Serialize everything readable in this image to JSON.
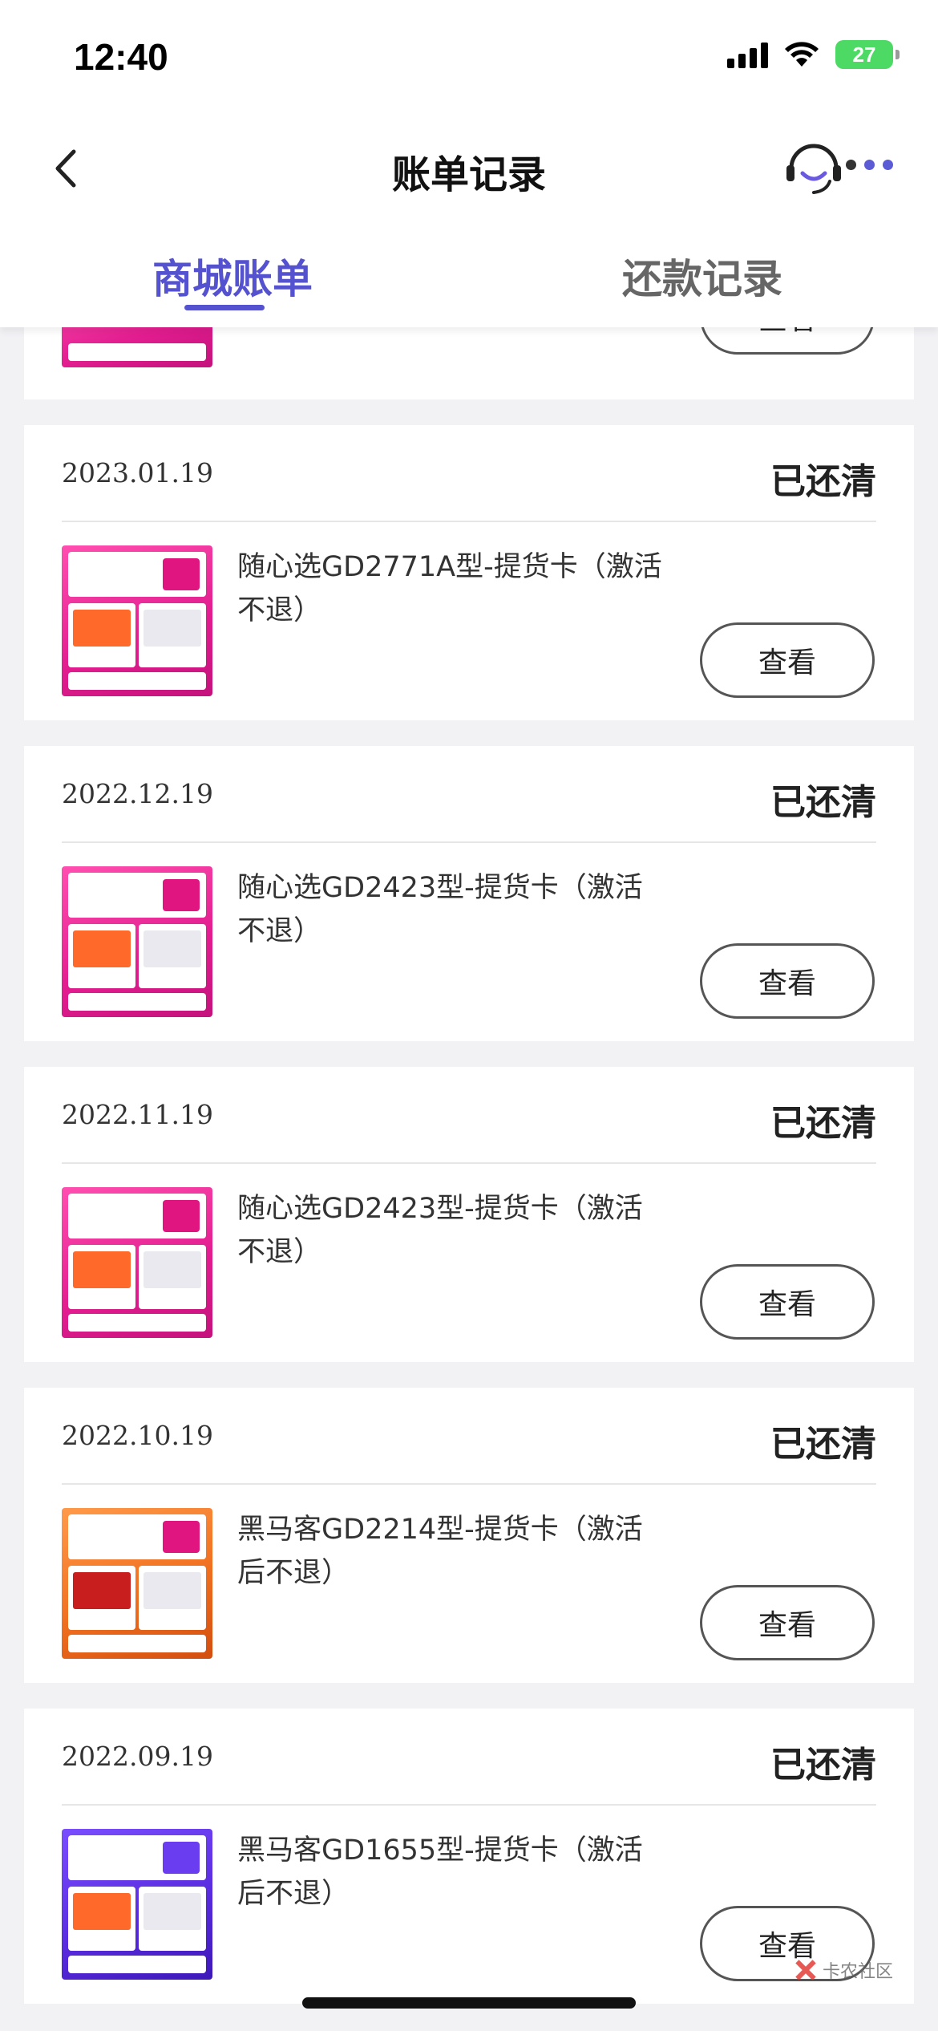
{
  "status_bar": {
    "time": "12:40",
    "battery": "27"
  },
  "header": {
    "title": "账单记录"
  },
  "tabs": [
    {
      "label": "商城账单",
      "active": true
    },
    {
      "label": "还款记录",
      "active": false
    }
  ],
  "partial_card": {
    "view_label": "查看"
  },
  "bills": [
    {
      "date": "2023.01.19",
      "status": "已还清",
      "product": "随心选GD2771A型-提货卡（激活不退）",
      "view_label": "查看",
      "thumb_style": "pink"
    },
    {
      "date": "2022.12.19",
      "status": "已还清",
      "product": "随心选GD2423型-提货卡（激活不退）",
      "view_label": "查看",
      "thumb_style": "pink"
    },
    {
      "date": "2022.11.19",
      "status": "已还清",
      "product": "随心选GD2423型-提货卡（激活不退）",
      "view_label": "查看",
      "thumb_style": "pink"
    },
    {
      "date": "2022.10.19",
      "status": "已还清",
      "product": "黑马客GD2214型-提货卡（激活后不退）",
      "view_label": "查看",
      "thumb_style": "orange"
    },
    {
      "date": "2022.09.19",
      "status": "已还清",
      "product": "黑马客GD1655型-提货卡（激活后不退）",
      "view_label": "查看",
      "thumb_style": "purple"
    }
  ],
  "watermark": {
    "text": "卡农社区"
  },
  "colors": {
    "accent": "#5552d0",
    "background": "#f2f2f5"
  }
}
